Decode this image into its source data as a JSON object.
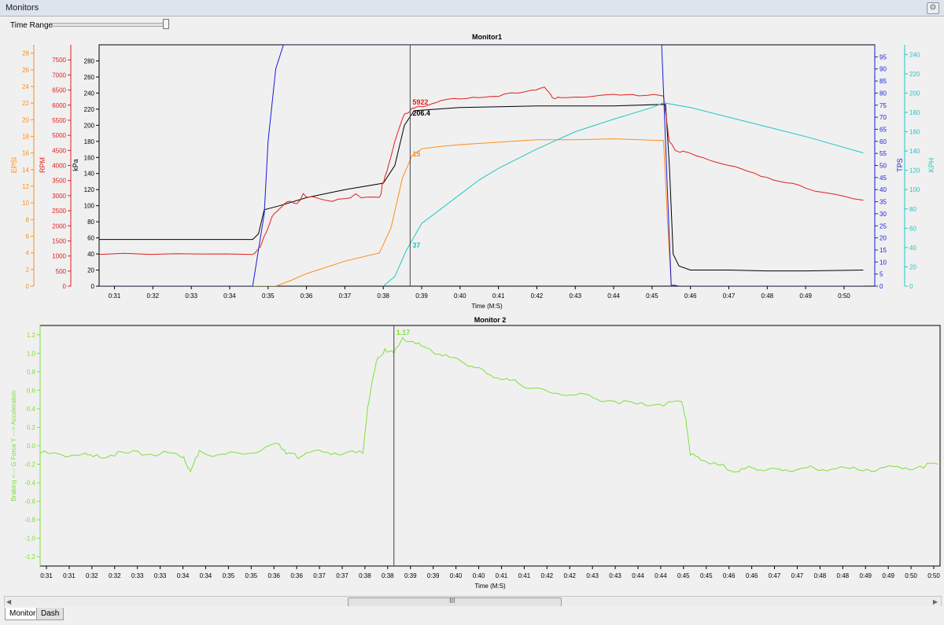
{
  "window": {
    "title": "Monitors"
  },
  "time_range": {
    "label": "Time Range",
    "position": 0.97
  },
  "tabs": [
    {
      "label": "Monitors"
    },
    {
      "label": "Dash"
    }
  ],
  "scroll_thumb_glyph": "III",
  "chart_data": [
    {
      "type": "line",
      "title": "Monitor1",
      "xlabel": "Time (M:S)",
      "x_ticks": [
        "0:31",
        "0:32",
        "0:33",
        "0:34",
        "0:35",
        "0:36",
        "0:37",
        "0:38",
        "0:39",
        "0:40",
        "0:41",
        "0:42",
        "0:43",
        "0:44",
        "0:45",
        "0:46",
        "0:47",
        "0:48",
        "0:49",
        "0:50"
      ],
      "cursor": {
        "x": "0:38.7",
        "labels": [
          {
            "series": "RPM",
            "text": "5922"
          },
          {
            "series": "kPa",
            "text": "206.4"
          },
          {
            "series": "EPSI",
            "text": "15"
          },
          {
            "series": "KPH",
            "text": "37"
          }
        ]
      },
      "axes": [
        {
          "name": "EPSI",
          "side": "left",
          "color": "#ff8c1a",
          "range": [
            0,
            29
          ],
          "ticks": [
            0,
            2,
            4,
            6,
            8,
            10,
            12,
            14,
            16,
            18,
            20,
            22,
            24,
            26,
            28
          ]
        },
        {
          "name": "RPM",
          "side": "left",
          "color": "#e02020",
          "range": [
            0,
            8000
          ],
          "ticks": [
            0,
            500,
            1000,
            1500,
            2000,
            2500,
            3000,
            3500,
            4000,
            4500,
            5000,
            5500,
            6000,
            6500,
            7000,
            7500
          ]
        },
        {
          "name": "kPa",
          "side": "left",
          "color": "#000000",
          "range": [
            0,
            300
          ],
          "ticks": [
            0,
            20,
            40,
            60,
            80,
            100,
            120,
            140,
            160,
            180,
            200,
            220,
            240,
            260,
            280
          ]
        },
        {
          "name": "TPS",
          "side": "right",
          "color": "#1a1adc",
          "range": [
            0,
            100
          ],
          "ticks": [
            0,
            5,
            10,
            15,
            20,
            25,
            30,
            35,
            40,
            45,
            50,
            55,
            60,
            65,
            70,
            75,
            80,
            85,
            90,
            95
          ]
        },
        {
          "name": "KPH",
          "side": "right",
          "color": "#1ec8c8",
          "range": [
            0,
            250
          ],
          "ticks": [
            0,
            20,
            40,
            60,
            80,
            100,
            120,
            140,
            160,
            180,
            200,
            220,
            240
          ]
        }
      ],
      "series": [
        {
          "name": "kPa",
          "axis": "kPa",
          "color": "#000000",
          "x": [
            30.6,
            34.6,
            34.75,
            34.9,
            35.3,
            36.0,
            37.0,
            38.0,
            38.3,
            38.55,
            38.8,
            40.0,
            42.0,
            44.0,
            45.35,
            45.45,
            45.55,
            45.7,
            46.0,
            47.0,
            48.0,
            49.0,
            50.5
          ],
          "y": [
            58,
            58,
            65,
            95,
            100,
            110,
            120,
            128,
            150,
            200,
            218,
            222,
            224,
            224,
            226,
            150,
            40,
            25,
            20,
            20,
            19,
            19,
            20
          ]
        },
        {
          "name": "RPM",
          "axis": "RPM",
          "color": "#e02020",
          "x": [
            30.6,
            34.6,
            34.8,
            35.1,
            35.5,
            36.0,
            37.0,
            37.85,
            38.0,
            38.3,
            38.55,
            38.8,
            39.5,
            40.5,
            41.5,
            42.2,
            42.4,
            42.6,
            43.5,
            44.5,
            45.3,
            45.45,
            45.6,
            46.0,
            47.0,
            48.0,
            49.0,
            50.5
          ],
          "y": [
            1050,
            1050,
            1300,
            2300,
            2800,
            2950,
            2900,
            2950,
            3400,
            4800,
            5700,
            5900,
            6150,
            6250,
            6400,
            6600,
            6250,
            6250,
            6300,
            6350,
            6300,
            4800,
            4500,
            4400,
            4000,
            3600,
            3250,
            2850
          ]
        },
        {
          "name": "EPSI",
          "axis": "EPSI",
          "color": "#ff8c1a",
          "x": [
            30.6,
            35.2,
            35.6,
            36.0,
            37.0,
            37.9,
            38.2,
            38.5,
            38.75,
            39.0,
            39.5,
            40.0,
            41.0,
            42.0,
            43.0,
            44.0,
            45.3,
            45.4,
            45.5
          ],
          "y": [
            0,
            0,
            0.7,
            1.5,
            3.0,
            4.0,
            7.0,
            13.0,
            15.7,
            16.5,
            16.8,
            17.0,
            17.3,
            17.6,
            17.6,
            17.7,
            17.5,
            8,
            0
          ]
        },
        {
          "name": "TPS",
          "axis": "TPS",
          "color": "#1a1adc",
          "x": [
            30.6,
            34.6,
            34.9,
            35.0,
            35.2,
            35.4,
            45.25,
            45.4,
            45.5,
            45.55,
            45.7,
            50.5
          ],
          "y": [
            0,
            0,
            30,
            60,
            90,
            100,
            100,
            40,
            0,
            0.5,
            0,
            0
          ]
        },
        {
          "name": "KPH",
          "axis": "KPH",
          "color": "#1ec8c8",
          "x": [
            38.0,
            38.3,
            38.6,
            39.0,
            39.5,
            40.0,
            40.5,
            41.0,
            42.0,
            43.0,
            44.0,
            45.0,
            45.3,
            46.0,
            47.0,
            48.0,
            49.0,
            50.5
          ],
          "y": [
            0,
            10,
            37,
            65,
            80,
            95,
            110,
            122,
            142,
            160,
            173,
            185,
            190,
            185,
            175,
            165,
            155,
            138
          ]
        }
      ]
    },
    {
      "type": "line",
      "title": "Monitor 2",
      "xlabel": "Time (M:S)",
      "ylabel": "Braking <--- G Force Y ---> Acceleration",
      "ylim": [
        -1.3,
        1.3
      ],
      "y_ticks": [
        -1.2,
        -1.0,
        -0.8,
        -0.6,
        -0.4,
        -0.2,
        -0.0,
        0.2,
        0.4,
        0.6,
        0.8,
        1.0,
        1.2
      ],
      "x_ticks": [
        "0:31",
        "0:31",
        "0:32",
        "0:32",
        "0:33",
        "0:33",
        "0:34",
        "0:34",
        "0:35",
        "0:35",
        "0:36",
        "0:36",
        "0:37",
        "0:37",
        "0:38",
        "0:38",
        "0:39",
        "0:39",
        "0:40",
        "0:40",
        "0:41",
        "0:41",
        "0:42",
        "0:42",
        "0:43",
        "0:43",
        "0:44",
        "0:44",
        "0:45",
        "0:45",
        "0:46",
        "0:46",
        "0:47",
        "0:47",
        "0:48",
        "0:48",
        "0:49",
        "0:49",
        "0:50",
        "0:50"
      ],
      "cursor": {
        "x": "0:38.5",
        "labels": [
          {
            "series": "G Force Y",
            "text": "1.17"
          }
        ]
      },
      "series": [
        {
          "name": "G Force Y",
          "color": "#7ee03a",
          "x": [
            30.5,
            31.0,
            31.4,
            31.7,
            32.1,
            32.5,
            33.0,
            33.5,
            33.75,
            33.9,
            34.1,
            34.5,
            35.0,
            35.5,
            35.9,
            36.1,
            36.3,
            36.5,
            37.0,
            37.4,
            37.8,
            37.9,
            38.1,
            38.3,
            38.5,
            38.7,
            39.0,
            39.3,
            39.6,
            40.0,
            40.3,
            40.6,
            41.0,
            41.3,
            41.6,
            42.0,
            42.5,
            43.0,
            43.5,
            44.0,
            44.5,
            45.0,
            45.1,
            45.2,
            45.5,
            45.8,
            46.0,
            46.3,
            46.6,
            46.9,
            47.2,
            47.6,
            48.0,
            48.5,
            49.0,
            49.5,
            50.0,
            50.4,
            50.8
          ],
          "y": [
            -0.08,
            -0.1,
            -0.1,
            -0.12,
            -0.1,
            -0.08,
            -0.09,
            -0.08,
            -0.12,
            -0.28,
            -0.05,
            -0.1,
            -0.08,
            -0.05,
            0.02,
            -0.08,
            -0.12,
            -0.08,
            -0.07,
            -0.08,
            -0.08,
            0.4,
            0.9,
            1.05,
            1.0,
            1.17,
            1.1,
            1.05,
            0.97,
            0.92,
            0.85,
            0.78,
            0.72,
            0.68,
            0.62,
            0.58,
            0.55,
            0.52,
            0.48,
            0.45,
            0.45,
            0.48,
            0.3,
            -0.1,
            -0.16,
            -0.2,
            -0.24,
            -0.28,
            -0.24,
            -0.27,
            -0.25,
            -0.26,
            -0.24,
            -0.25,
            -0.26,
            -0.24,
            -0.25,
            -0.22,
            -0.2
          ]
        }
      ]
    }
  ]
}
